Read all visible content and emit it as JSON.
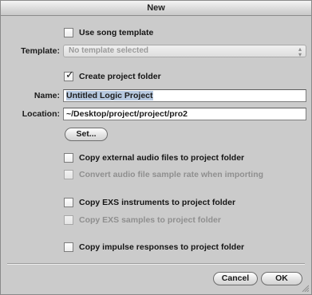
{
  "window": {
    "title": "New"
  },
  "options": {
    "use_song_template": {
      "label": "Use song template",
      "checked": false,
      "enabled": true
    },
    "create_project_folder": {
      "label": "Create project folder",
      "checked": true,
      "enabled": true
    },
    "copy_external_audio": {
      "label": "Copy external audio files to project folder",
      "checked": false,
      "enabled": true
    },
    "convert_sample_rate": {
      "label": "Convert audio file sample rate when importing",
      "checked": false,
      "enabled": false
    },
    "copy_exs_instruments": {
      "label": "Copy EXS instruments to project folder",
      "checked": false,
      "enabled": true
    },
    "copy_exs_samples": {
      "label": "Copy EXS samples to project folder",
      "checked": false,
      "enabled": false
    },
    "copy_impulse_responses": {
      "label": "Copy impulse responses to project folder",
      "checked": false,
      "enabled": true
    }
  },
  "template": {
    "label": "Template:",
    "selected_value": "No template selected",
    "enabled": false
  },
  "name": {
    "label": "Name:",
    "value": "Untitled Logic Project"
  },
  "location": {
    "label": "Location:",
    "value": "~/Desktop/project/project/pro2"
  },
  "buttons": {
    "set_label": "Set...",
    "cancel_label": "Cancel",
    "ok_label": "OK"
  },
  "icons": {
    "checkmark": "checkmark-icon",
    "popup_arrows": "updown-arrows-icon",
    "resize_grip": "resize-grip-icon"
  }
}
